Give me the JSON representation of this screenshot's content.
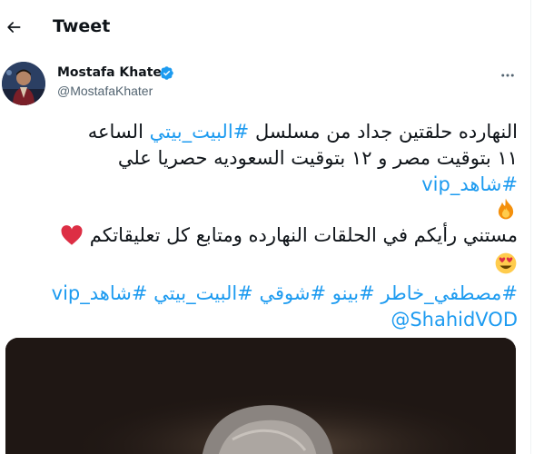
{
  "header": {
    "title": "Tweet",
    "back_icon": "arrow-left-icon"
  },
  "author": {
    "name": "Mostafa Khater",
    "handle": "@MostafaKhater",
    "verified": true,
    "verified_color": "#1d9bf0"
  },
  "tweet": {
    "line1_pre": "النهارده حلقتين جداد من مسلسل ",
    "line1_hashtag": "#البيت_بيتي",
    "line1_post": " الساعه",
    "line2": "١١ بتوقيت مصر و ١٢ بتوقيت السعوديه حصريا علي",
    "line3_hashtag": "#شاهد_vip",
    "line4_emoji": "fire-emoji",
    "line5_text": "مستني رأيكم في الحلقات النهارده ومتابع كل تعليقاتكم",
    "line5_emoji": "red-heart-emoji",
    "line6_emoji": "heart-eyes-emoji",
    "hashtags_line": [
      "#مصطفي_خاطر",
      "#بينو",
      "#شوقي",
      "#البيت_بيتي",
      "#شاهد_vip"
    ],
    "mention": "@ShahidVOD"
  },
  "colors": {
    "link": "#1d9bf0",
    "text": "#0f1419",
    "secondary": "#536471"
  }
}
